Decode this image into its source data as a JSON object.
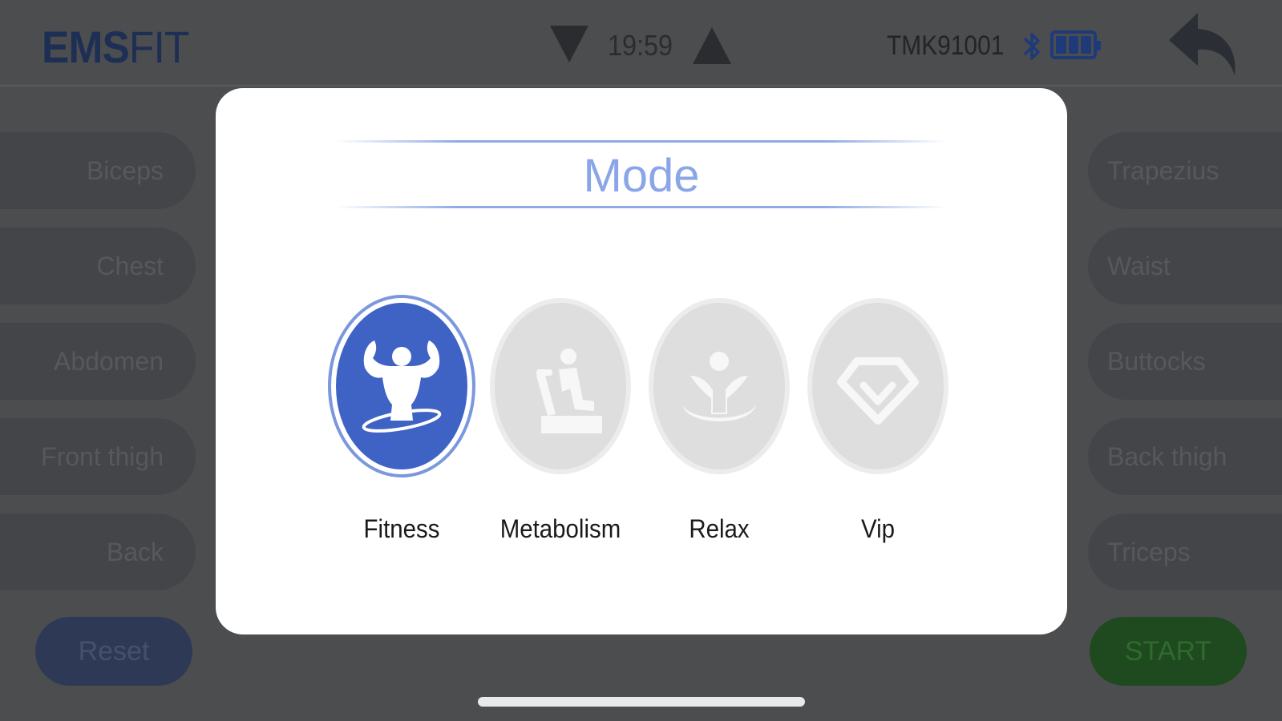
{
  "header": {
    "brand_bold": "EMS",
    "brand_regular": "FIT",
    "clock": "19:59",
    "device_id": "TMK91001"
  },
  "left_buttons": [
    "Biceps",
    "Chest",
    "Abdomen",
    "Front thigh",
    "Back"
  ],
  "right_buttons": [
    "Trapezius",
    "Waist",
    "Buttocks",
    "Back thigh",
    "Triceps"
  ],
  "footer": {
    "reset_label": "Reset",
    "start_label": "START"
  },
  "modal": {
    "title": "Mode",
    "modes": [
      {
        "label": "Fitness",
        "icon": "bodybuilder-icon",
        "selected": true
      },
      {
        "label": "Metabolism",
        "icon": "exercise-bike-icon",
        "selected": false
      },
      {
        "label": "Relax",
        "icon": "relax-figure-icon",
        "selected": false
      },
      {
        "label": "Vip",
        "icon": "diamond-icon",
        "selected": false
      }
    ]
  },
  "colors": {
    "accent_blue": "#3e63c4",
    "title_blue": "#8aa6e8",
    "inactive_gray": "#dedede",
    "backdrop": "#4c4d4f"
  }
}
